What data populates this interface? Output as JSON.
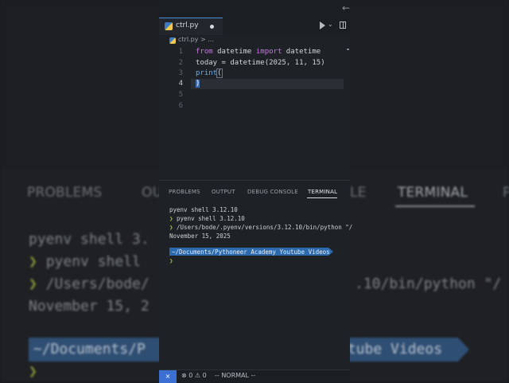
{
  "background": {
    "tabs": [
      "PROBLEMS",
      "OU",
      "LE",
      "TERMINAL",
      "P"
    ],
    "lines": [
      "pyenv shell 3.",
      "pyenv shell",
      "/Users/bode/",
      ".10/bin/python \"/",
      "November 15, 2"
    ],
    "prompt_glyph": "❯",
    "path_left": "~/Documents/P",
    "path_right": "utube Videos"
  },
  "titlebar": {
    "back_icon": "←"
  },
  "editor_tab": {
    "label": "ctrl.py",
    "icon": "python-icon"
  },
  "toolbar": {
    "run_chevron": "⌄"
  },
  "breadcrumb": {
    "file": "ctrl.py",
    "separator": ">",
    "more": "..."
  },
  "editor": {
    "line_numbers": [
      "1",
      "2",
      "3",
      "4",
      "5",
      "6"
    ],
    "active_line": "4",
    "lines": [
      {
        "tokens": [
          {
            "t": "from",
            "c": "kw"
          },
          {
            "t": " datetime ",
            "c": ""
          },
          {
            "t": "import",
            "c": "kw"
          },
          {
            "t": " datetime",
            "c": ""
          }
        ]
      },
      {
        "tokens": [
          {
            "t": "today",
            "c": ""
          },
          {
            "t": " = ",
            "c": ""
          },
          {
            "t": "datetime",
            "c": ""
          },
          {
            "t": "(",
            "c": ""
          },
          {
            "t": "2025",
            "c": ""
          },
          {
            "t": ", ",
            "c": ""
          },
          {
            "t": "11",
            "c": ""
          },
          {
            "t": ", ",
            "c": ""
          },
          {
            "t": "15",
            "c": ""
          },
          {
            "t": ")",
            "c": ""
          }
        ]
      },
      {
        "tokens": [
          {
            "t": "print",
            "c": "fn"
          },
          {
            "t": "(",
            "c": "paren"
          }
        ]
      },
      {
        "tokens": [
          {
            "t": ")",
            "c": "sel"
          }
        ]
      }
    ]
  },
  "panel": {
    "tabs": [
      "PROBLEMS",
      "OUTPUT",
      "DEBUG CONSOLE",
      "TERMINAL"
    ],
    "active_tab": "TERMINAL",
    "terminal": {
      "line1": "pyenv shell 3.12.10",
      "prompt": "❯",
      "line2": "pyenv shell 3.12.10",
      "line3": "/Users/bode/.pyenv/versions/3.12.10/bin/python \"/",
      "line4": "November 15, 2025",
      "path": "~/Documents/Pythoneer Academy Youtube Videos",
      "prompt_last": "❯"
    }
  },
  "statusbar": {
    "remote_icon": "⨯",
    "errors": "⊗ 0 ⚠ 0",
    "mode": "-- NORMAL --"
  },
  "colors": {
    "accent": "#3b6fd1",
    "prompt": "#a8c23c",
    "path_bg": "#2b6aad"
  }
}
